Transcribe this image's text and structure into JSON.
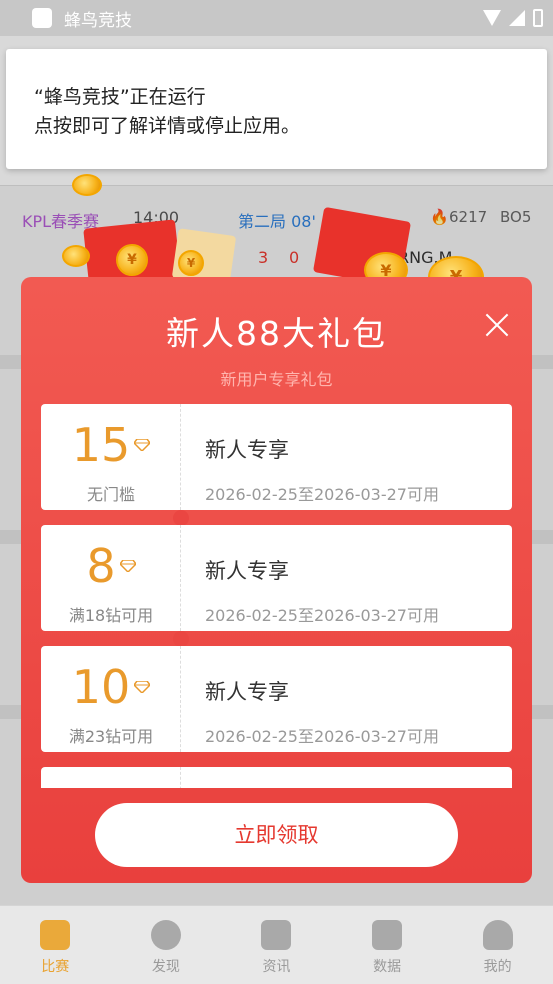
{
  "status_bar": {
    "app_name": "蜂鸟竞技"
  },
  "notification": {
    "line1": "“蜂鸟竞技”正在运行",
    "line2": "点按即可了解详情或停止应用。"
  },
  "background": {
    "match": {
      "league": "KPL春季赛",
      "time": "14:00",
      "round": "第二局 08'",
      "score_left": "3",
      "score_right": "0",
      "team": "RNG.M",
      "heat": "6217",
      "format": "BO5"
    }
  },
  "modal": {
    "title": "新人88大礼包",
    "subtitle": "新用户专享礼包",
    "coupons": [
      {
        "amount": "15",
        "condition": "无门槛",
        "name": "新人专享",
        "validity": "2026-02-25至2026-03-27可用"
      },
      {
        "amount": "8",
        "condition": "满18钻可用",
        "name": "新人专享",
        "validity": "2026-02-25至2026-03-27可用"
      },
      {
        "amount": "10",
        "condition": "满23钻可用",
        "name": "新人专享",
        "validity": "2026-02-25至2026-03-27可用"
      }
    ],
    "claim_label": "立即领取"
  },
  "tabs": [
    {
      "label": "比赛",
      "icon": "trophy-icon",
      "active": true
    },
    {
      "label": "发现",
      "icon": "compass-icon",
      "active": false
    },
    {
      "label": "资讯",
      "icon": "news-icon",
      "active": false
    },
    {
      "label": "数据",
      "icon": "chart-icon",
      "active": false
    },
    {
      "label": "我的",
      "icon": "profile-icon",
      "active": false
    }
  ],
  "colors": {
    "accent": "#e9a230",
    "modal_red": "#ea4642",
    "coupon_amount": "#e99a2c",
    "claim_text": "#e5382f"
  }
}
